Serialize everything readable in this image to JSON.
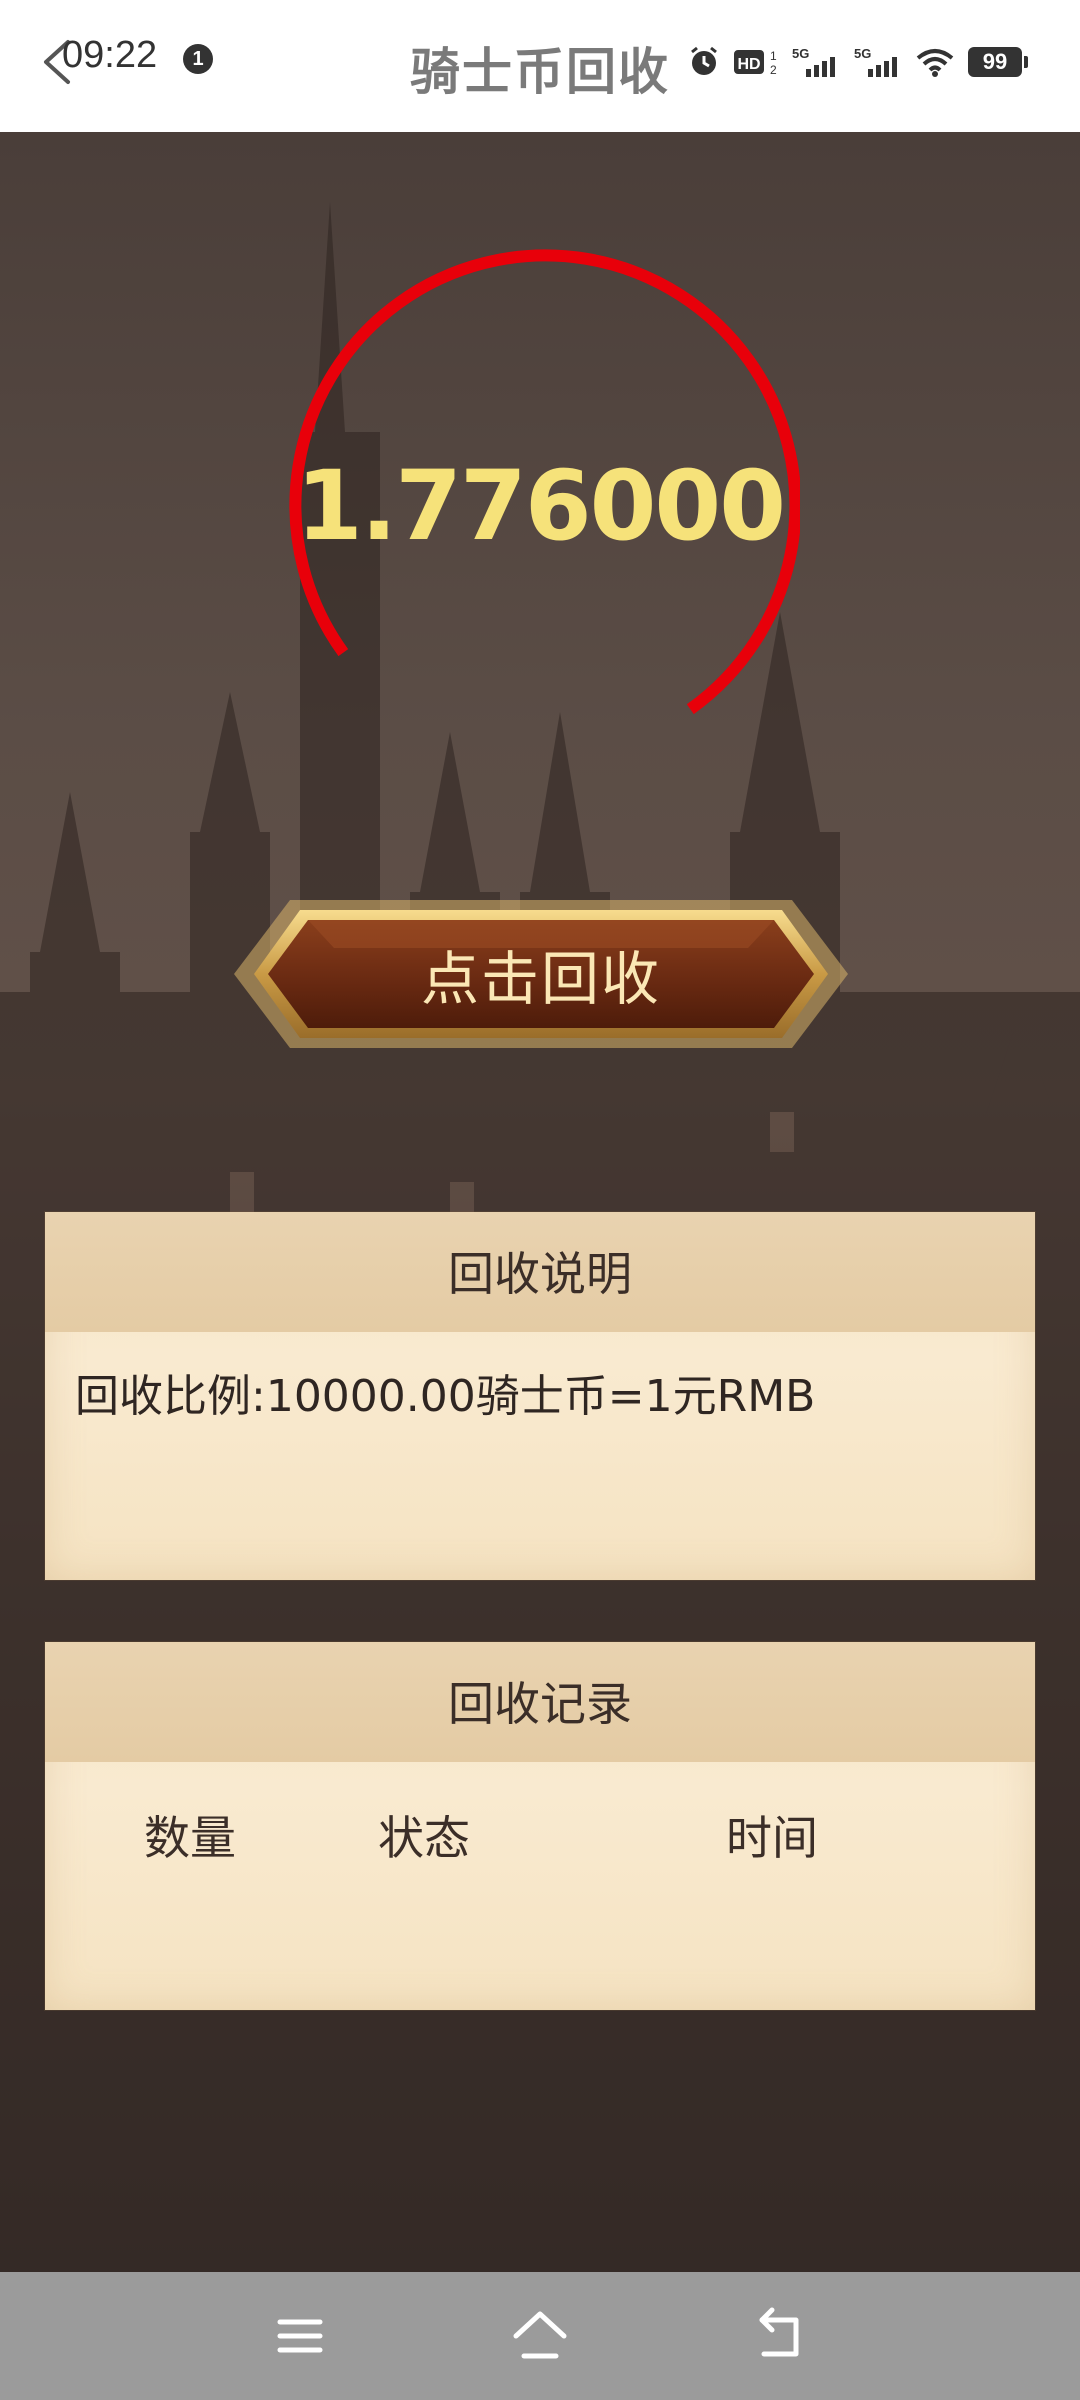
{
  "status_bar": {
    "time": "09:22",
    "notification_count": "1",
    "battery": "99",
    "icons": [
      "alarm-icon",
      "hd-icon",
      "5g-signal-icon",
      "5g-signal-icon",
      "wifi-icon",
      "battery-icon"
    ]
  },
  "header": {
    "title": "骑士币回收"
  },
  "gauge": {
    "value": "1.776000",
    "ring_color": "#e8000a",
    "text_color": "#f6e27a"
  },
  "recycle_button": {
    "label": "点击回收"
  },
  "info_panel": {
    "title": "回收说明",
    "text": "回收比例:10000.00骑士币=1元RMB"
  },
  "records_panel": {
    "title": "回收记录",
    "columns": [
      "数量",
      "状态",
      "时间"
    ]
  },
  "nav_bar": {
    "buttons": [
      "menu-icon",
      "home-icon",
      "back-icon"
    ]
  }
}
